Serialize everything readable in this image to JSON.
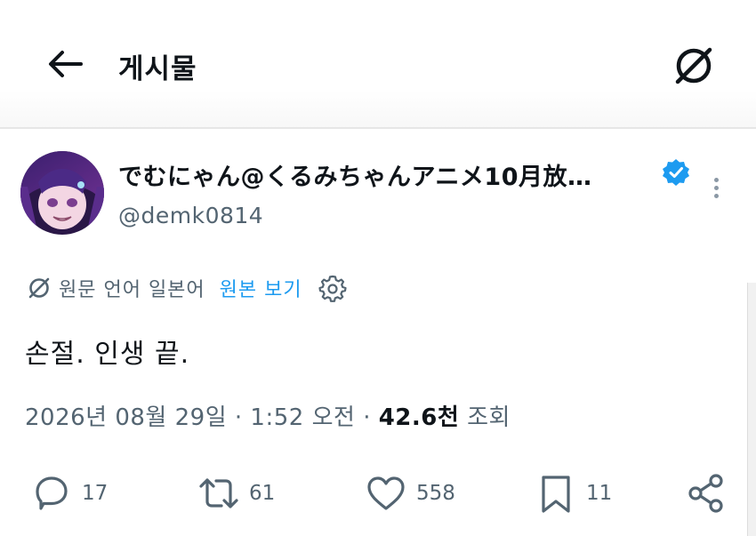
{
  "header": {
    "title": "게시물",
    "back_icon": "arrow-left-icon",
    "translate_icon": "translate-off-icon"
  },
  "author": {
    "display_name": "でむにゃん@くるみちゃんアニメ10月放…",
    "handle": "@demk0814",
    "verified_icon": "verified-badge-icon",
    "verified_color": "#1d9bf0"
  },
  "translation": {
    "source_language": "원문 언어 일본어",
    "show_original": "원본 보기"
  },
  "post": {
    "text": "손절. 인생 끝."
  },
  "meta": {
    "timestamp": "2026년 08월 29일 · 1:52 오전",
    "separator": "·",
    "views_count": "42.6천",
    "views_label": "조회"
  },
  "actions": {
    "replies": "17",
    "reposts": "61",
    "likes": "558",
    "bookmarks": "11"
  },
  "colors": {
    "accent": "#1d9bf0",
    "text_primary": "#0f1419",
    "text_secondary": "#536471"
  }
}
